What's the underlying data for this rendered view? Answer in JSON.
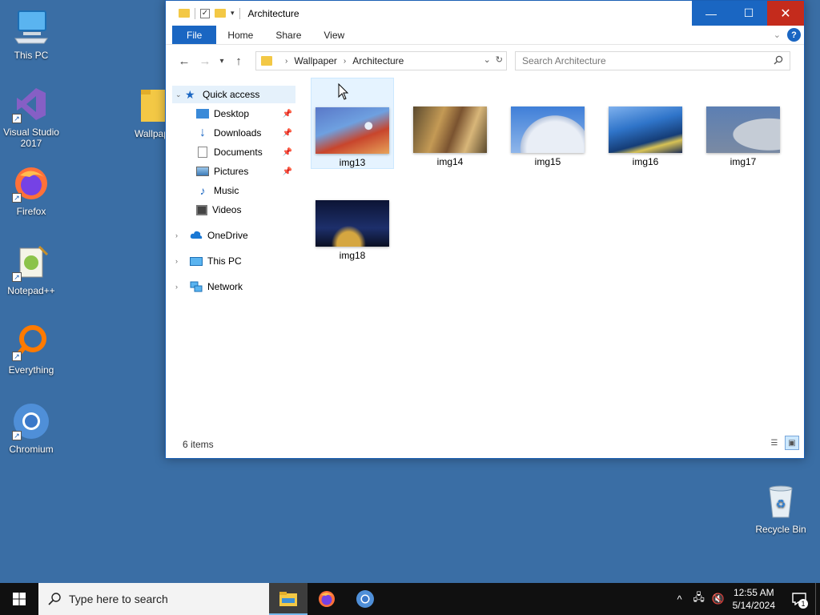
{
  "desktop": {
    "icons": [
      {
        "label": "This PC",
        "icon": "computer-icon"
      },
      {
        "label": "Visual Studio 2017",
        "icon": "visual-studio-icon"
      },
      {
        "label": "Firefox",
        "icon": "firefox-icon"
      },
      {
        "label": "Notepad++",
        "icon": "notepadpp-icon"
      },
      {
        "label": "Everything",
        "icon": "everything-icon"
      },
      {
        "label": "Chromium",
        "icon": "chromium-icon"
      },
      {
        "label": "Wallpaper",
        "icon": "folder-icon"
      },
      {
        "label": "Recycle Bin",
        "icon": "recycle-bin-icon"
      }
    ]
  },
  "window": {
    "title": "Architecture",
    "buttons": {
      "minimize": "—",
      "maximize": "☐",
      "close": "✕"
    },
    "ribbon_tabs": [
      "File",
      "Home",
      "Share",
      "View"
    ],
    "breadcrumb": [
      "Wallpaper",
      "Architecture"
    ],
    "search_placeholder": "Search Architecture",
    "nav": {
      "quick_access": "Quick access",
      "pinned": [
        {
          "label": "Desktop",
          "pinned": true
        },
        {
          "label": "Downloads",
          "pinned": true
        },
        {
          "label": "Documents",
          "pinned": true
        },
        {
          "label": "Pictures",
          "pinned": true
        },
        {
          "label": "Music",
          "pinned": false
        },
        {
          "label": "Videos",
          "pinned": false
        }
      ],
      "roots": [
        "OneDrive",
        "This PC",
        "Network"
      ]
    },
    "files": [
      {
        "name": "img13",
        "colors": [
          "#5a78c8",
          "#c8452c",
          "#e7a35a"
        ]
      },
      {
        "name": "img14",
        "colors": [
          "#7a5330",
          "#c49a55",
          "#5b4a2e"
        ]
      },
      {
        "name": "img15",
        "colors": [
          "#3f7fd8",
          "#e9eef6",
          "#b5c4dc"
        ]
      },
      {
        "name": "img16",
        "colors": [
          "#2f74c9",
          "#153d77",
          "#d7c255"
        ]
      },
      {
        "name": "img17",
        "colors": [
          "#5c7fb3",
          "#c5ccd6",
          "#7a8aa3"
        ]
      },
      {
        "name": "img18",
        "colors": [
          "#0c1434",
          "#d5a640",
          "#1d2f6b"
        ]
      }
    ],
    "status": "6 items"
  },
  "taskbar": {
    "search_placeholder": "Type here to search",
    "time": "12:55 AM",
    "date": "5/14/2024",
    "notification_count": "1"
  },
  "colors": {
    "desktop": "#3a6ea5",
    "accent": "#1a66c2",
    "close": "#c42b1c"
  }
}
